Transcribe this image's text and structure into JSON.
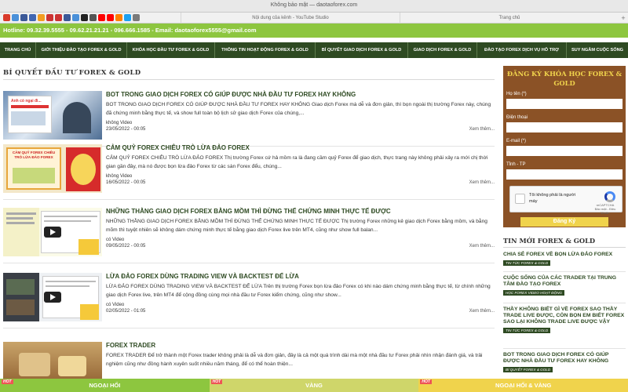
{
  "browser": {
    "window_title": "Không bảo mật — daotaoforex.com",
    "tabs": [
      "Nội dung của kênh - YouTube Studio",
      "Trang chủ"
    ],
    "favicons": [
      "#d93a2b",
      "#4a90d9",
      "#3b5998",
      "#4267b2",
      "#f29d22",
      "#c33",
      "#c33",
      "#3b5998",
      "#4a90d9",
      "#222",
      "#555",
      "#f00",
      "#f00",
      "#ff7f00",
      "#1da1f2",
      "#7a7a7a"
    ],
    "new_tab_label": "+"
  },
  "site": {
    "hotline": "Hotline: 09.32.39.5555 - 09.62.21.21.21 - 096.666.1585 - Email: daotaoforex5555@gmail.com",
    "nav": [
      "TRANG CHỦ",
      "GIỚI THIỆU ĐÀO TẠO FOREX & GOLD",
      "KHÓA HỌC ĐẦU TƯ FOREX & GOLD",
      "THÔNG TIN HOẠT ĐỘNG FOREX & GOLD",
      "BÍ QUYẾT GIAO DỊCH FOREX & GOLD",
      "GIAO DỊCH FOREX & GOLD",
      "ĐÀO TẠO FOREX DỊCH VỤ HỖ TRỢ",
      "SUY NGẪM CUỘC SỐNG"
    ]
  },
  "main": {
    "section_title": "BÍ QUYẾT ĐẦU TƯ FOREX & GOLD",
    "read_more": "Xem thêm...",
    "articles": [
      {
        "title": "BOT TRONG GIAO DỊCH FOREX CÓ GIÚP ĐƯỢC NHÀ ĐẦU TƯ FOREX HAY KHÔNG",
        "excerpt": "BOT TRONG GIAO DỊCH FOREX CÓ GIÚP ĐƯỢC NHÀ ĐẦU TƯ FOREX HAY KHÔNG      Giao dịch Forex mà dễ và đơn giản, thì bọn ngoài thị trường Forex này, chúng đã chứng minh bằng thực tế, và show full toàn bộ lịch sử giao dịch Forex của chúng,...",
        "category": "không Video",
        "date": "23/05/2022 - 00:05",
        "thumb_caption": "Anh có ngại đi..."
      },
      {
        "title": "CẢM QUỶ FOREX CHIÊU TRÒ LỪA ĐẢO FOREX",
        "excerpt": "CẢM QUỶ FOREX CHIÊU TRÒ LỪA ĐẢO FOREX   Thị trường Forex cứ hả mồm ra là đang cầm quỷ Forex để giao dịch, thực trang này không phải xảy ra mới chị thời gian gần đây, mà nó được bọn lừa đảo Forex từ các sàn Forex đểu, chúng...",
        "category": "không Video",
        "date": "16/05/2022 - 00:05",
        "thumb_caption": "CẢM QUỶ FOREX CHIÊU TRÒ LỪA ĐẢO FOREX"
      },
      {
        "title": "NHỮNG THẰNG GIAO DỊCH FOREX BẰNG MỒM THÌ ĐỪNG THỂ CHỨNG MINH THỰC TẾ ĐƯỢC",
        "excerpt": "NHỮNG THẰNG GIAO DỊCH FOREX BẰNG MỒM THÌ ĐỪNG THỂ CHỨNG MINH THỰC TẾ ĐƯỢC Thị trường Forex những kẻ giao dịch Forex bằng mồm, và bằng mõm thì tuyệt nhiên sẽ không dám chứng minh thực tế bằng giao dịch Forex live trên MT4, cũng như show full balan...",
        "category": "có Video",
        "date": "09/05/2022 - 00:05",
        "thumb_caption": ""
      },
      {
        "title": "LỪA ĐẢO FOREX DÙNG TRADING VIEW VÀ BACKTEST ĐỂ LỪA",
        "excerpt": "LỪA ĐẢO FOREX DÙNG TRADING VIEW VÀ BACKTEST ĐỂ LỪA Trên thị trường Forex bọn lừa đảo Forex có khi nào dám chứng minh bằng thực tế, từ chính những giao dịch Forex live, trên MT4 để cộng đồng cùng mọi nhà đầu tư Forex kiểm chứng, cũng như show...",
        "category": "có Video",
        "date": "02/05/2022 - 01:05",
        "thumb_caption": ""
      },
      {
        "title": "FOREX TRADER",
        "excerpt": "FOREX TRADER Để trở thành một Forex trader không phải là dễ và đơn giản, đây là cả một quá trình dài mà một nhà đầu tư Forex phải nhìn nhận đánh giá, và trải nghiệm cũng như đồng hành xuyên suốt nhiều năm tháng, để có thể hoàn thiện...",
        "category": "",
        "date": "",
        "thumb_caption": ""
      }
    ]
  },
  "sidebar": {
    "form_title": "ĐĂNG KÝ KHÓA HỌC FOREX & GOLD",
    "fields": [
      "Họ tên (*)",
      "Điện thoại",
      "E-mail (*)",
      "Tỉnh - TP"
    ],
    "captcha_text": "Tôi không phải là người máy",
    "captcha_brand": "reCAPTCHA",
    "captcha_links": "Bảo mật - Điều khoản",
    "submit_label": "Đăng Ký",
    "news_title": "TIN MỚI FOREX & GOLD",
    "news": [
      {
        "title": "CHIA SẺ FOREX VỀ BỌN LỪA ĐẢO FOREX",
        "tag": "TIN TỨC FOREX & GOLD"
      },
      {
        "title": "CUỘC SỐNG CỦA CÁC TRADER TẠI TRUNG TÂM ĐÀO TẠO FOREX",
        "tag": "HỌC FOREX VIDEO HOẠT ĐỘNG"
      },
      {
        "title": "THẦY KHÔNG BIẾT GÌ VỀ FOREX SAO THẦY TRADE LIVE ĐƯỢC, CÒN BỌN EM BIẾT FOREX SAO LẠI KHÔNG TRADE LIVE ĐƯỢC VẬY",
        "tag": "TIN TỨC FOREX & GOLD"
      },
      {
        "title": "BOT TRONG GIAO DỊCH FOREX CÓ GIÚP ĐƯỢC NHÀ ĐẦU TƯ FOREX HAY KHÔNG",
        "tag": "BÍ QUYẾT FOREX & GOLD"
      }
    ]
  },
  "bottom_bar": {
    "items": [
      "NGOẠI HỐI",
      "VÀNG",
      "NGOẠI HỐI & VÀNG"
    ],
    "badge": "HOT",
    "colors": [
      "#8dc63f",
      "#e0e06a",
      "#f0d34c"
    ]
  },
  "colors": {
    "hotline_green": "#8dc63f",
    "nav_dark_green": "#2e4a22",
    "form_brown": "#8b5226",
    "form_title_yellow": "#f0d34c"
  }
}
